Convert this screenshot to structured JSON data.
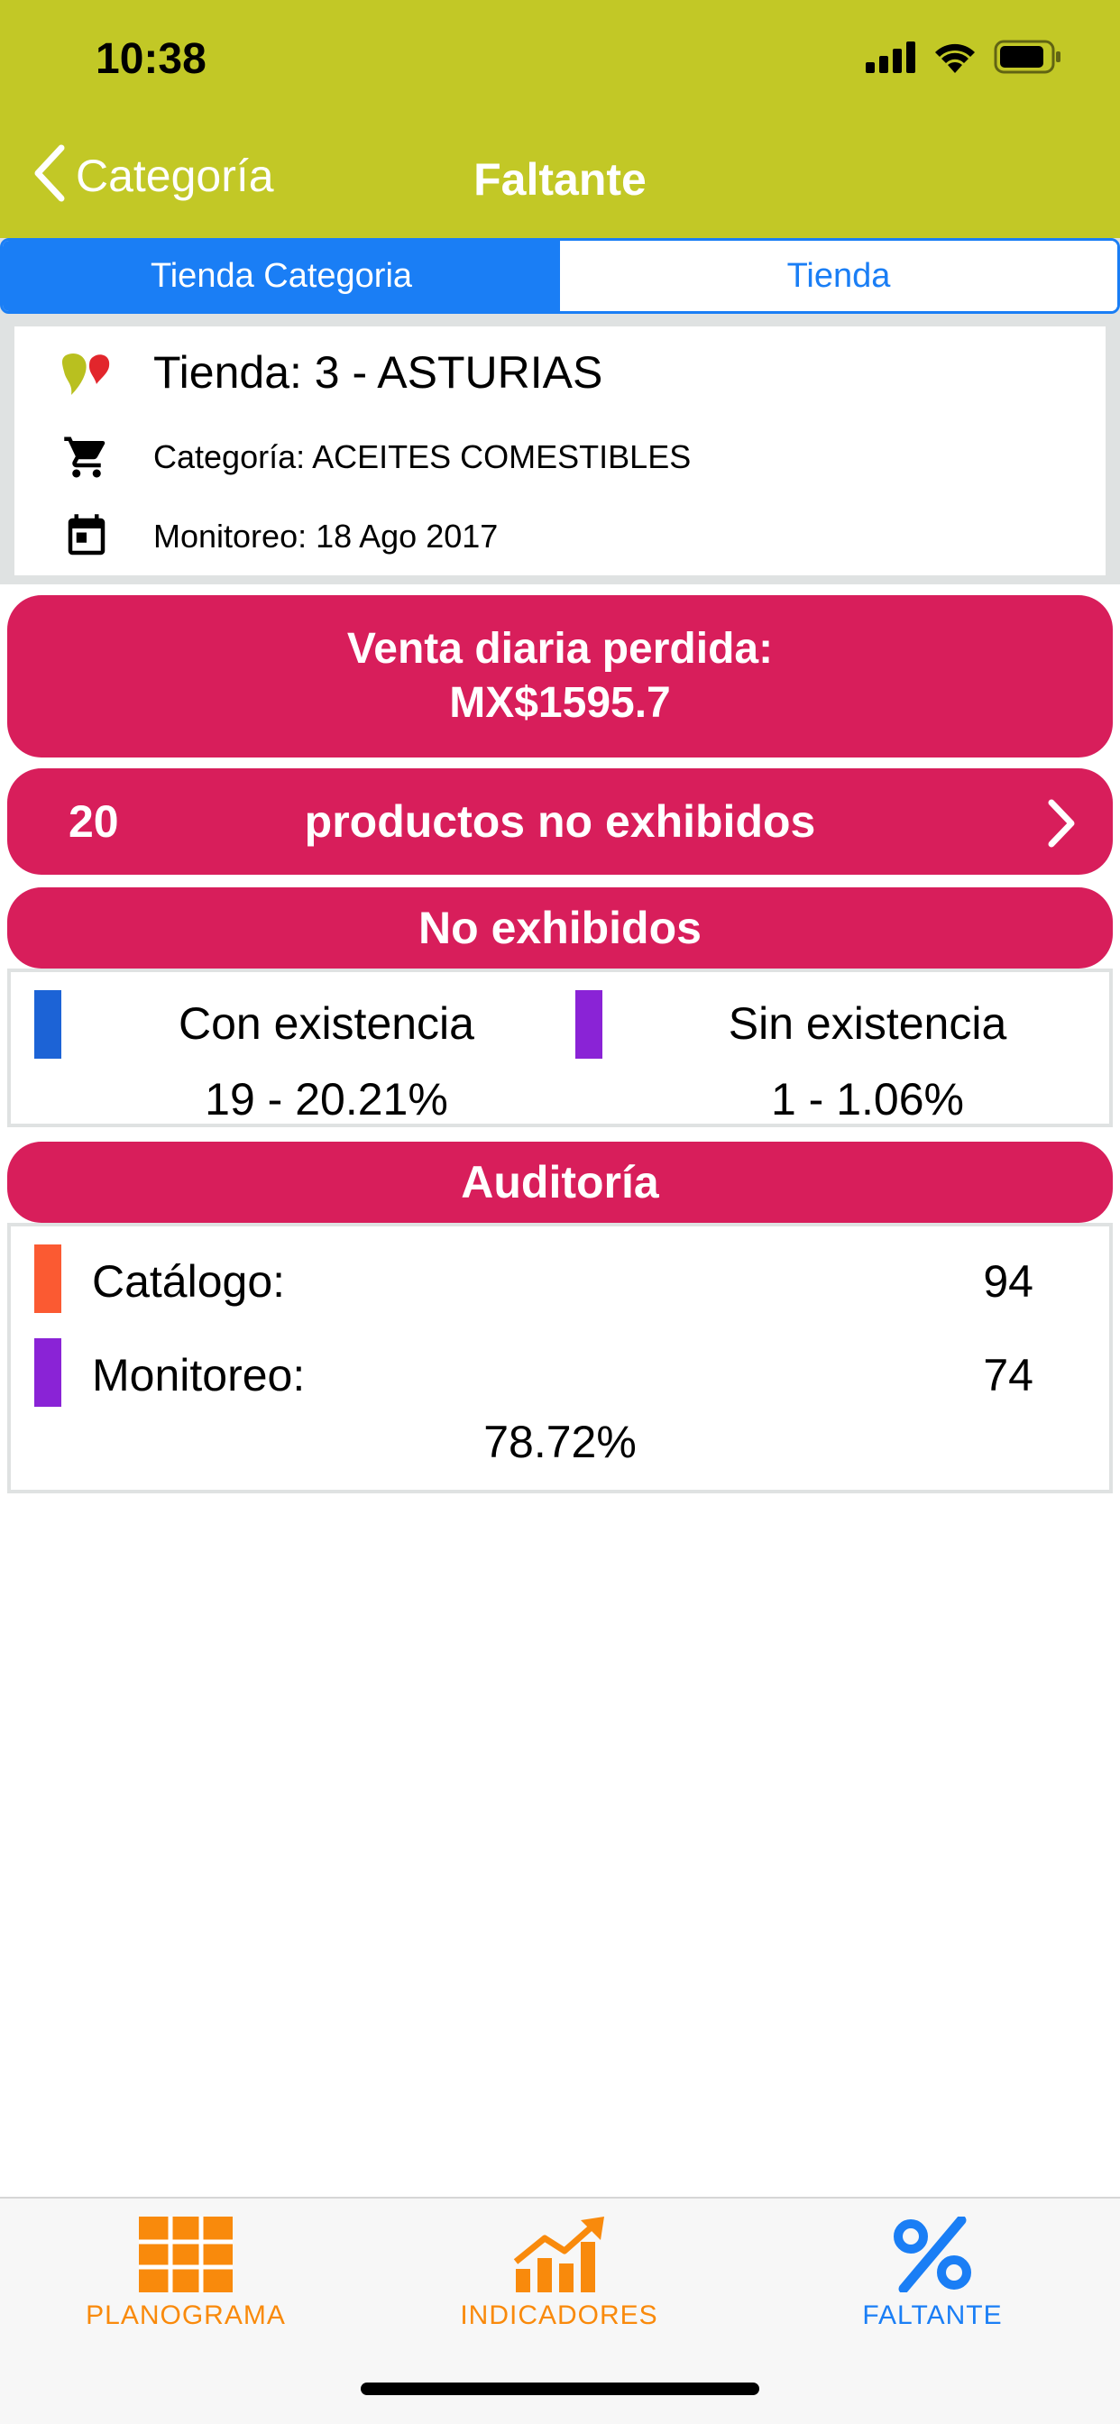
{
  "status_bar": {
    "time": "10:38"
  },
  "nav": {
    "back_label": "Categoría",
    "title": "Faltante"
  },
  "segments": [
    {
      "label": "Tienda Categoria",
      "selected": true
    },
    {
      "label": "Tienda",
      "selected": false
    }
  ],
  "info": {
    "store": "Tienda: 3 - ASTURIAS",
    "category": "Categoría: ACEITES COMESTIBLES",
    "monitoring": "Monitoreo: 18 Ago 2017"
  },
  "loss": {
    "label": "Venta diaria perdida:",
    "amount": "MX$1595.7"
  },
  "products": {
    "count": "20",
    "label": "productos no exhibidos"
  },
  "no_exhibidos": {
    "title": "No exhibidos",
    "con": {
      "label": "Con existencia",
      "value": "19 - 20.21%",
      "color": "#1c63d6"
    },
    "sin": {
      "label": "Sin existencia",
      "value": "1 - 1.06%",
      "color": "#8a23d6"
    }
  },
  "auditoria": {
    "title": "Auditoría",
    "catalogo": {
      "label": "Catálogo:",
      "value": "94",
      "color": "#fb5a32"
    },
    "monitoreo": {
      "label": "Monitoreo:",
      "value": "74",
      "color": "#8a23d6"
    },
    "percent": "78.72%"
  },
  "tabbar": {
    "planograma": "PLANOGRAMA",
    "indicadores": "INDICADORES",
    "faltante": "FALTANTE"
  },
  "colors": {
    "header": "#c2c826",
    "accent": "#d81e5b",
    "segment_blue": "#1a7ef5",
    "tab_orange": "#f98a0c",
    "tab_active": "#1a7ef5"
  }
}
